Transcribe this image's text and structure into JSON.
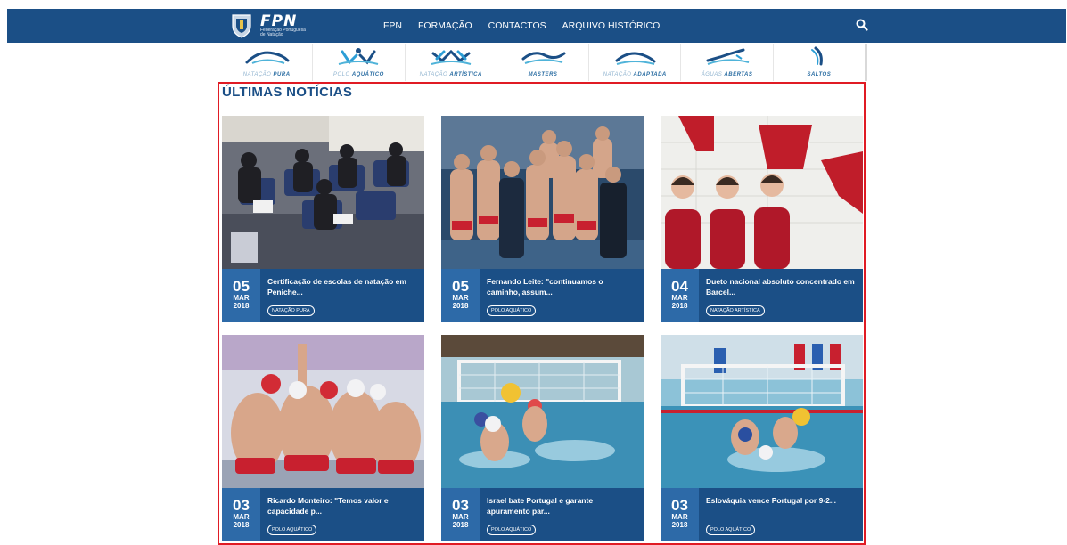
{
  "header": {
    "logo_title": "FPN",
    "logo_subtitle_1": "Federação Portuguesa",
    "logo_subtitle_2": "de Natação",
    "nav": [
      "FPN",
      "FORMAÇÃO",
      "CONTACTOS",
      "ARQUIVO HISTÓRICO"
    ],
    "search_icon": "search-icon",
    "bar_color": "#1b4f86"
  },
  "disciplines": [
    {
      "light": "NATAÇÃO",
      "bold": "PURA"
    },
    {
      "light": "POLO",
      "bold": "AQUÁTICO"
    },
    {
      "light": "NATAÇÃO",
      "bold": "ARTÍSTICA"
    },
    {
      "light": "",
      "bold": "MASTERS"
    },
    {
      "light": "NATAÇÃO",
      "bold": "ADAPTADA"
    },
    {
      "light": "ÁGUAS",
      "bold": "ABERTAS"
    },
    {
      "light": "",
      "bold": "SALTOS"
    }
  ],
  "news": {
    "title": "ÚLTIMAS NOTÍCIAS",
    "items": [
      {
        "day": "05",
        "month": "MAR",
        "year": "2018",
        "headline": "Certificação de escolas de natação em Peniche...",
        "tag": "NATAÇÃO PURA"
      },
      {
        "day": "05",
        "month": "MAR",
        "year": "2018",
        "headline": "Fernando Leite: \"continuamos o caminho, assum...",
        "tag": "POLO AQUÁTICO"
      },
      {
        "day": "04",
        "month": "MAR",
        "year": "2018",
        "headline": "Dueto nacional absoluto concentrado em Barcel...",
        "tag": "NATAÇÃO ARTÍSTICA"
      },
      {
        "day": "03",
        "month": "MAR",
        "year": "2018",
        "headline": "Ricardo Monteiro: \"Temos valor e capacidade p...",
        "tag": "POLO AQUÁTICO"
      },
      {
        "day": "03",
        "month": "MAR",
        "year": "2018",
        "headline": "Israel bate Portugal e garante apuramento par...",
        "tag": "POLO AQUÁTICO"
      },
      {
        "day": "03",
        "month": "MAR",
        "year": "2018",
        "headline": "Eslováquia vence Portugal por 9-2...",
        "tag": "POLO AQUÁTICO"
      }
    ]
  },
  "colors": {
    "primary": "#1b4f86",
    "date_box": "#2d6aa8",
    "highlight": "#e01b24"
  }
}
